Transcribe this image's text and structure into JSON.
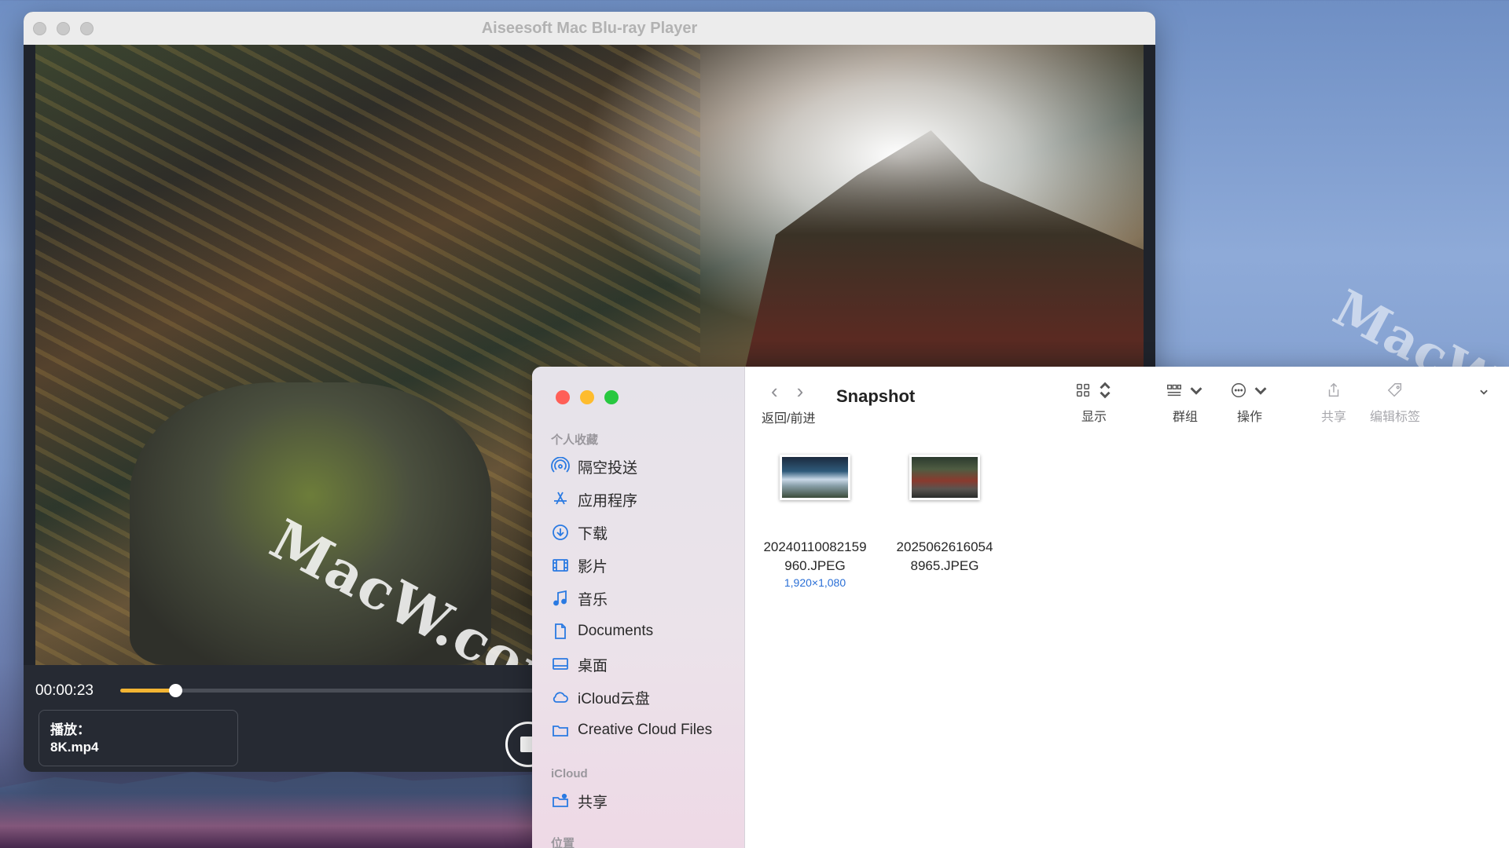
{
  "desktop": {
    "watermark": "MacW.com"
  },
  "player": {
    "title": "Aiseesoft Mac Blu-ray Player",
    "time": "00:00:23",
    "progress": 0.125,
    "now_playing_label": "播放：",
    "now_playing_file": "8K.mp4"
  },
  "finder": {
    "folder": "Snapshot",
    "nav_label": "返回/前进",
    "toolbar": [
      {
        "label": "显示",
        "icon": "grid-view-icon"
      },
      {
        "label": "群组",
        "icon": "group-icon"
      },
      {
        "label": "操作",
        "icon": "ellipsis-circle-icon"
      },
      {
        "label": "共享",
        "icon": "share-icon"
      },
      {
        "label": "编辑标签",
        "icon": "tag-icon"
      }
    ],
    "sidebar": {
      "favorites_header": "个人收藏",
      "favorites": [
        {
          "label": "隔空投送",
          "icon": "airdrop-icon"
        },
        {
          "label": "应用程序",
          "icon": "applications-icon"
        },
        {
          "label": "下载",
          "icon": "download-icon"
        },
        {
          "label": "影片",
          "icon": "film-icon"
        },
        {
          "label": "音乐",
          "icon": "music-icon"
        },
        {
          "label": "Documents",
          "icon": "document-icon"
        },
        {
          "label": "桌面",
          "icon": "desktop-icon"
        },
        {
          "label": "iCloud云盘",
          "icon": "icloud-icon"
        },
        {
          "label": "Creative Cloud Files",
          "icon": "folder-icon"
        }
      ],
      "icloud_header": "iCloud",
      "icloud": [
        {
          "label": "共享",
          "icon": "shared-folder-icon"
        }
      ],
      "locations_header": "位置"
    },
    "files": [
      {
        "line1": "20240110082159",
        "line2": "960.JPEG",
        "dims": "1,920×1,080"
      },
      {
        "line1": "2025062616054",
        "line2": "8965.JPEG",
        "dims": ""
      }
    ],
    "colors": {
      "accent": "#1a73e8",
      "dims_text": "#2a6fd6"
    }
  }
}
